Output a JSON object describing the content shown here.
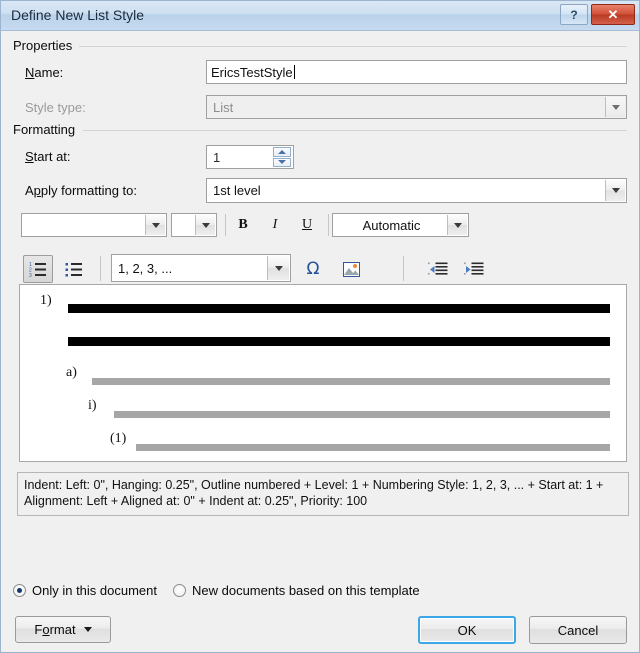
{
  "window": {
    "title": "Define New List Style",
    "help_button": "?",
    "close_button": "✕"
  },
  "properties": {
    "group_label": "Properties",
    "name": {
      "label_prefix": "",
      "label_accel": "N",
      "label_suffix": "ame:",
      "value": "EricsTestStyle"
    },
    "style_type": {
      "label": "Style type:",
      "value": "List",
      "disabled": true
    }
  },
  "formatting": {
    "group_label": "Formatting",
    "start_at": {
      "label_accel": "S",
      "label_suffix": "tart at:",
      "value": "1"
    },
    "apply_to": {
      "label_prefix": "A",
      "label_accel": "p",
      "label_suffix": "ply formatting to:",
      "value": "1st level"
    },
    "font_name": {
      "value": "",
      "placeholder": ""
    },
    "font_size": {
      "value": "",
      "placeholder": ""
    },
    "bold": "B",
    "italic": "I",
    "underline": "U",
    "font_color": {
      "value": "Automatic"
    }
  },
  "list_toolbar": {
    "numbered_list": "numbered-list",
    "bulleted_list": "bulleted-list",
    "number_style": {
      "value": "1, 2, 3, ..."
    },
    "insert_symbol": "Ω",
    "insert_picture": "picture",
    "decrease_indent": "decrease-indent",
    "increase_indent": "increase-indent"
  },
  "preview": {
    "levels": [
      {
        "marker": "1)",
        "bars": 2,
        "color": "#000000"
      },
      {
        "marker": "a)",
        "bars": 1,
        "color": "#a6a6a6"
      },
      {
        "marker": "i)",
        "bars": 1,
        "color": "#a6a6a6"
      },
      {
        "marker": "(1)",
        "bars": 1,
        "color": "#a6a6a6"
      }
    ]
  },
  "description": {
    "text": "Indent: Left:  0\", Hanging:  0.25\", Outline numbered + Level: 1 + Numbering Style: 1, 2, 3, ... + Start at: 1 + Alignment: Left + Aligned at:  0\" + Indent at:  0.25\", Priority: 100"
  },
  "scope": {
    "only_this_document": "Only in this document",
    "new_documents": "New documents based on this template",
    "selected": "only_this_document"
  },
  "footer": {
    "format_prefix": "F",
    "format_accel": "o",
    "format_suffix": "rmat",
    "ok": "OK",
    "cancel": "Cancel"
  },
  "colors": {
    "accent": "#3ba7e6",
    "title_gradient_top": "#d9e7f5",
    "close_red": "#d1503a",
    "preview_dark_bar": "#000000",
    "preview_gray_bar": "#a6a6a6",
    "radio_dot": "#15386b"
  }
}
